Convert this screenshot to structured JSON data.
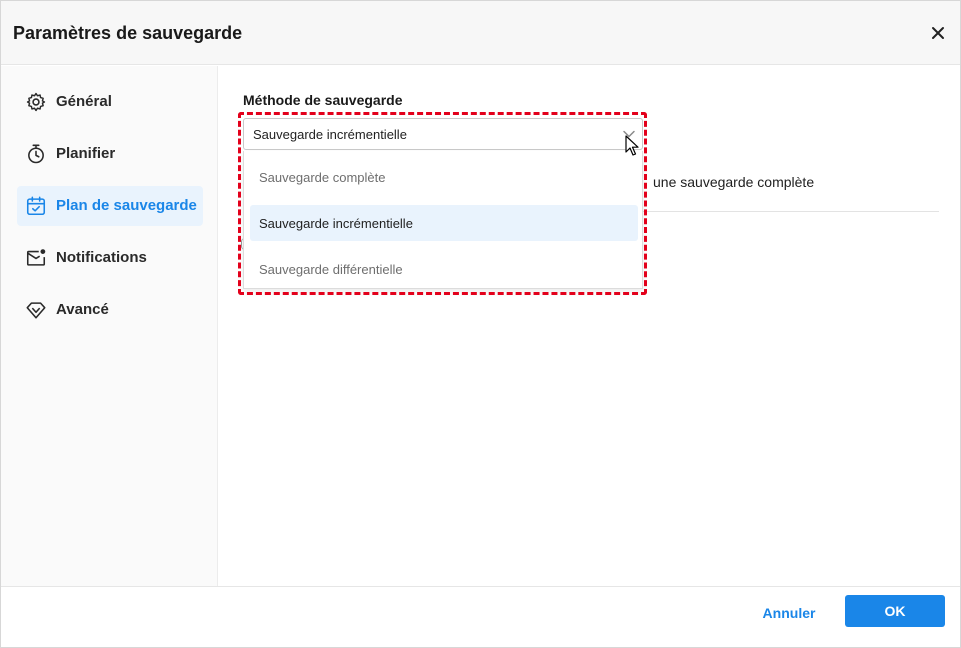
{
  "window": {
    "title": "Paramètres de sauvegarde",
    "close_icon": "close-icon"
  },
  "sidebar": {
    "items": [
      {
        "label": "Général",
        "icon": "gear-icon",
        "active": false
      },
      {
        "label": "Planifier",
        "icon": "stopwatch-icon",
        "active": false
      },
      {
        "label": "Plan de sauvegarde",
        "icon": "calendar-check-icon",
        "active": true
      },
      {
        "label": "Notifications",
        "icon": "mail-notification-icon",
        "active": false
      },
      {
        "label": "Avancé",
        "icon": "diamond-icon",
        "active": false
      }
    ]
  },
  "main": {
    "section_label": "Méthode de sauvegarde",
    "select": {
      "value": "Sauvegarde incrémentielle",
      "options": [
        "Sauvegarde complète",
        "Sauvegarde incrémentielle",
        "Sauvegarde différentielle"
      ],
      "selected_index": 1
    },
    "background_text": "une sauvegarde complète"
  },
  "footer": {
    "cancel_label": "Annuler",
    "ok_label": "OK"
  },
  "colors": {
    "accent": "#1a86e8",
    "highlight_border": "#e3001b",
    "active_bg": "#e9f3fd"
  }
}
